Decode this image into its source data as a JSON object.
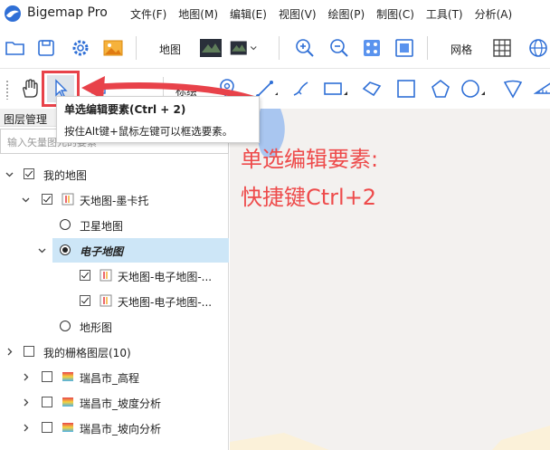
{
  "app": {
    "title": "Bigemap Pro",
    "menu": [
      "文件(F)",
      "地图(M)",
      "编辑(E)",
      "视图(V)",
      "绘图(P)",
      "制图(C)",
      "工具(T)",
      "分析(A)"
    ]
  },
  "toolbar1": {
    "map_label": "地图",
    "grid_label": "网格"
  },
  "toolbar2": {
    "mark_label": "标绘"
  },
  "tooltip": {
    "title": "单选编辑要素(Ctrl + 2)",
    "desc": "按住Alt键+鼠标左键可以框选要素。"
  },
  "panel": {
    "title": "图层管理",
    "search_placeholder": "输入矢量图元的要素",
    "tree": [
      {
        "label": "我的地图",
        "checked": true
      },
      {
        "label": "天地图-墨卡托",
        "checked": true
      },
      {
        "label": "卫星地图"
      },
      {
        "label": "电子地图"
      },
      {
        "label": "天地图-电子地图-...",
        "checked": true
      },
      {
        "label": "天地图-电子地图-...",
        "checked": true
      },
      {
        "label": "地形图"
      },
      {
        "label": "我的栅格图层(10)",
        "checked": false
      },
      {
        "label": "瑞昌市_高程",
        "checked": false
      },
      {
        "label": "瑞昌市_坡度分析",
        "checked": false
      },
      {
        "label": "瑞昌市_坡向分析",
        "checked": false
      }
    ]
  },
  "annotation": {
    "line1": "单选编辑要素:",
    "line2": "快捷键Ctrl+2"
  },
  "colors": {
    "annotation_red": "#e8424a",
    "selected_row": "#cde6f7",
    "icon_blue": "#2f6fd6"
  }
}
